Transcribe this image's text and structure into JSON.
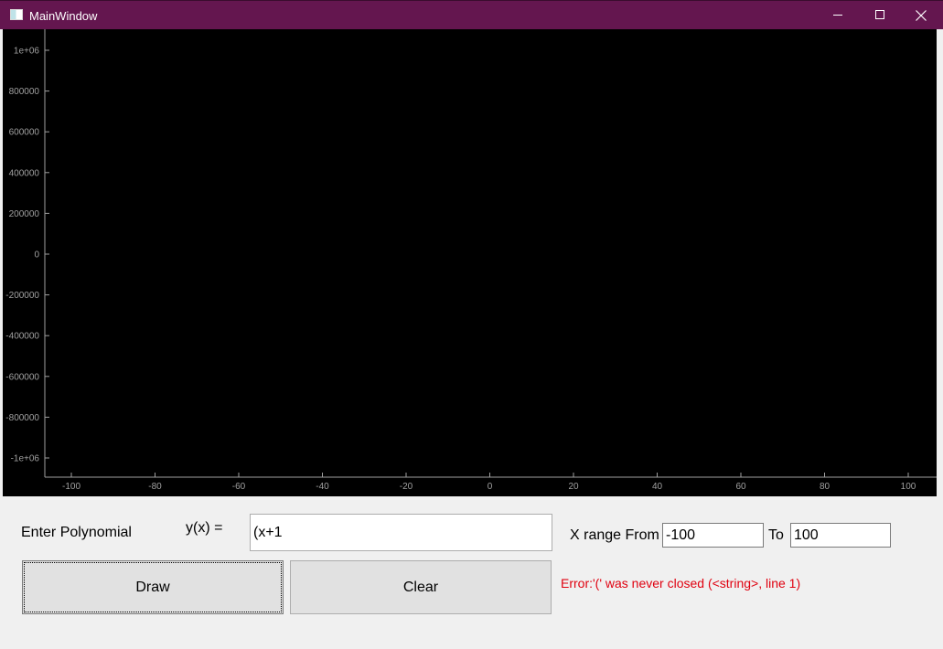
{
  "window": {
    "title": "MainWindow",
    "controls": {
      "minimize_icon": "minimize-icon",
      "maximize_icon": "maximize-icon",
      "close_icon": "close-icon"
    }
  },
  "plot": {
    "background": "#000000",
    "axis_color": "#a0a0a0",
    "y_ticks": [
      "1e+06",
      "800000",
      "600000",
      "400000",
      "200000",
      "0",
      "-200000",
      "-400000",
      "-600000",
      "-800000",
      "-1e+06"
    ],
    "x_ticks": [
      "-100",
      "-80",
      "-60",
      "-40",
      "-20",
      "0",
      "20",
      "40",
      "60",
      "80",
      "100"
    ]
  },
  "form": {
    "enter_label": "Enter Polynomial",
    "yx_label": "y(x) =",
    "polynomial_value": "(x+1",
    "xrange_label": "X range From",
    "x_from_value": "-100",
    "to_label": "To",
    "x_to_value": "100",
    "draw_label": "Draw",
    "clear_label": "Clear",
    "error_message": "Error:'(' was never closed (<string>, line 1)",
    "error_color": "#e0000f"
  }
}
